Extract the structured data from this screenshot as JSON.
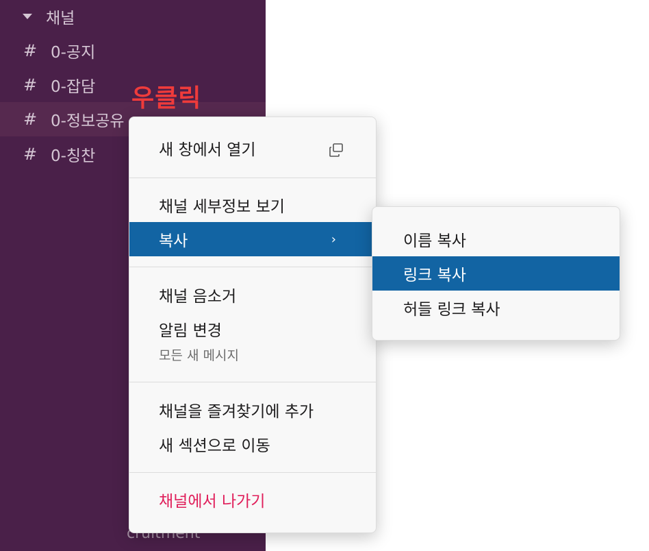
{
  "sidebar": {
    "section_label": "채널",
    "channels": [
      {
        "hash": "#",
        "name": "0-공지"
      },
      {
        "hash": "#",
        "name": "0-잡담"
      },
      {
        "hash": "#",
        "name": "0-정보공유"
      },
      {
        "hash": "#",
        "name": "0-칭찬"
      }
    ],
    "partial_channel_text": "cruitment"
  },
  "annotation": "우클릭",
  "context_menu": {
    "open_new_window": "새 창에서 열기",
    "view_details": "채널 세부정보 보기",
    "copy": "복사",
    "copy_chevron": "›",
    "mute": "채널 음소거",
    "notifications": "알림 변경",
    "notifications_sub": "모든 새 메시지",
    "add_favorite": "채널을 즐겨찾기에 추가",
    "move_section": "새 섹션으로 이동",
    "leave": "채널에서 나가기"
  },
  "copy_submenu": {
    "copy_name": "이름 복사",
    "copy_link": "링크 복사",
    "copy_huddle_link": "허들 링크 복사"
  },
  "colors": {
    "sidebar_bg": "#4a2049",
    "highlight": "#1264a3",
    "danger": "#e01e5a",
    "annotation": "#ef3b3b"
  }
}
